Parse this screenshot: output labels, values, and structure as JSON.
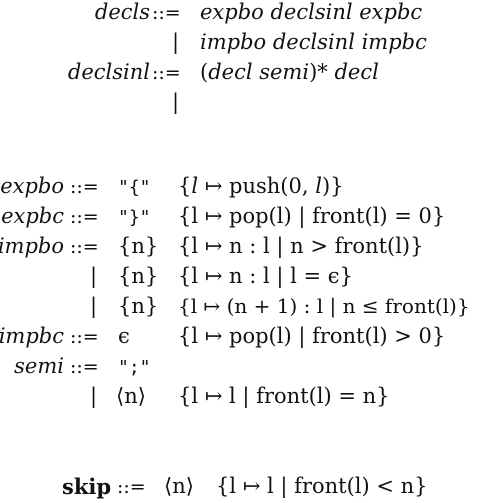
{
  "grammar1": {
    "rows": [
      {
        "lhs": "decls",
        "op": "::=",
        "rhs": "expbo declsinl expbc"
      },
      {
        "lhs": "",
        "op": "|",
        "rhs": "impbo declsinl impbc"
      },
      {
        "lhs": "declsinl",
        "op": "::=",
        "rhs_open": "(",
        "rhs_decl": "decl semi",
        "rhs_close": ")*",
        "rhs_tail": "decl"
      },
      {
        "lhs": "",
        "op": "|",
        "rhs": ""
      }
    ]
  },
  "grammar2": {
    "rows": [
      {
        "lhs": "expbo",
        "op": "::=",
        "tok": "\"{\"",
        "act_pre": "{",
        "act_l": "l",
        "act_mid": " ↦ push(0, ",
        "act_l2": "l",
        "act_post": ")}"
      },
      {
        "lhs": "expbc",
        "op": "::=",
        "tok": "\"}\"",
        "act": "{l ↦ pop(l) | front(l) = 0}"
      },
      {
        "lhs": "impbo",
        "op": "::=",
        "tok": "{n}",
        "act": "{l ↦ n : l | n > front(l)}"
      },
      {
        "lhs": "",
        "op": "|",
        "tok": "{n}",
        "act": "{l ↦ n : l | l = ϵ}"
      },
      {
        "lhs": "",
        "op": "|",
        "tok": "{n}",
        "act": "{l ↦ (n + 1) : l | n ≤ front(l)}"
      },
      {
        "lhs": "impbc",
        "op": "::=",
        "tok": "ϵ",
        "act": "{l ↦ pop(l) | front(l) > 0}"
      },
      {
        "lhs": "semi",
        "op": "::=",
        "tok": "\";\"",
        "act": ""
      },
      {
        "lhs": "",
        "op": "|",
        "tok": "⟨n⟩",
        "act": "{l ↦ l | front(l) = n}"
      }
    ]
  },
  "grammar3": {
    "lhs": "skip",
    "op": "::=",
    "tok": "⟨n⟩",
    "act": "{l ↦ l | front(l) < n}"
  }
}
